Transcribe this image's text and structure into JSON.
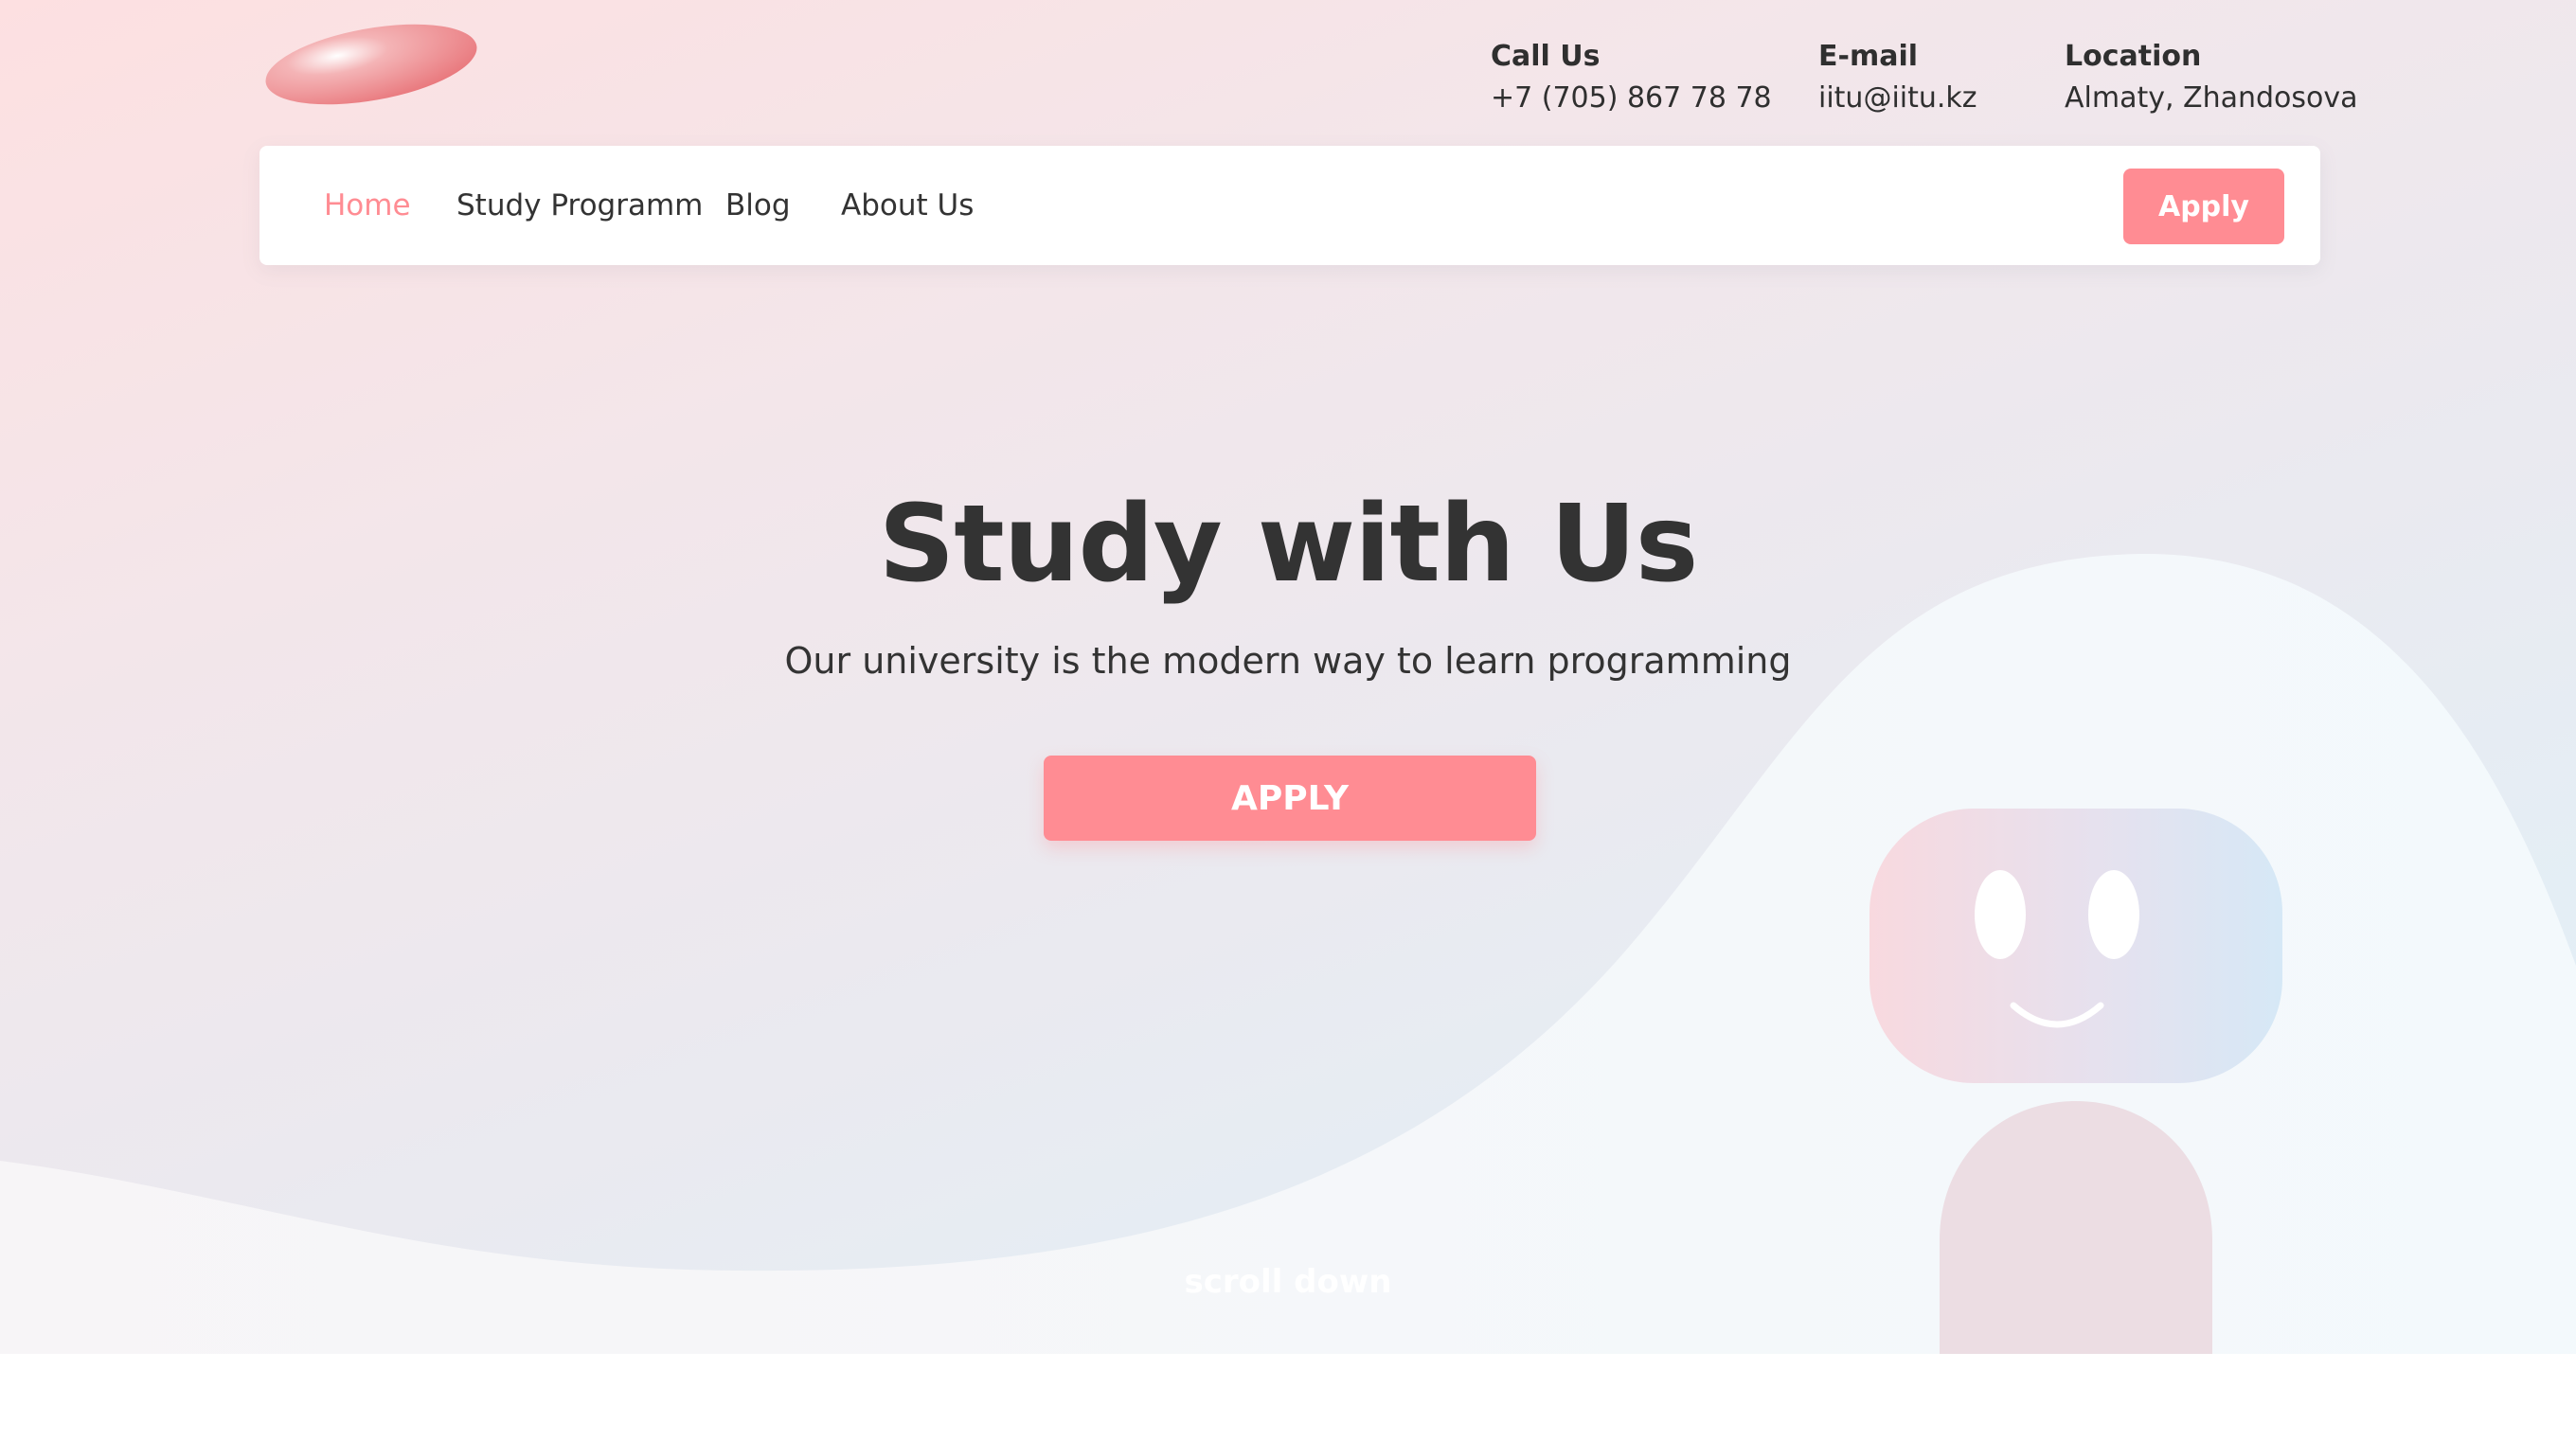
{
  "contacts": {
    "call": {
      "title": "Call Us",
      "value": "+7 (705) 867 78 78"
    },
    "email": {
      "title": "E-mail",
      "value": "iitu@iitu.kz"
    },
    "location": {
      "title": "Location",
      "value": "Almaty, Zhandosova"
    }
  },
  "nav": {
    "items": [
      {
        "label": "Home",
        "active": true
      },
      {
        "label": "Study Programm",
        "active": false
      },
      {
        "label": "Blog",
        "active": false
      },
      {
        "label": "About Us",
        "active": false
      }
    ],
    "apply_label": "Apply"
  },
  "hero": {
    "title": "Study with Us",
    "subtitle": "Our university is the modern way to learn programming",
    "apply_label": "APPLY",
    "scroll_label": "scroll down"
  },
  "icons": {
    "logo": "logo-ellipse",
    "mascot": "robot-mascot"
  },
  "colors": {
    "accent": "#ff8c93",
    "text": "#333333",
    "navbar_bg": "#ffffff"
  }
}
